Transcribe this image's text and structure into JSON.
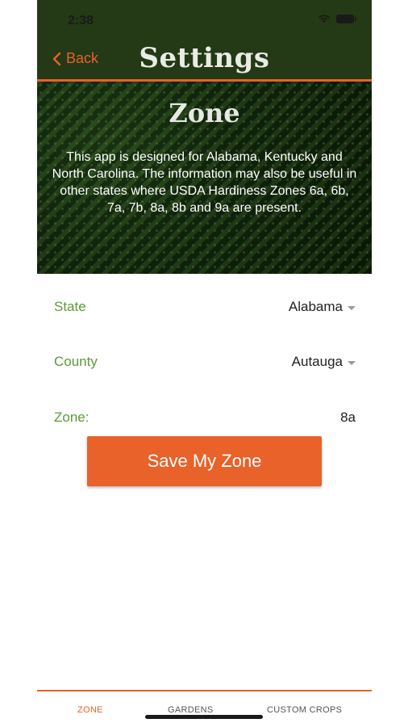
{
  "status_bar": {
    "time": "2:38"
  },
  "nav": {
    "back_label": "Back",
    "title": "Settings"
  },
  "hero": {
    "title": "Zone",
    "description": "This app is designed for Alabama, Kentucky and North Carolina. The information may also be useful in other states where USDA Hardiness Zones 6a, 6b, 7a, 7b, 8a, 8b and 9a are present."
  },
  "form": {
    "state": {
      "label": "State",
      "value": "Alabama"
    },
    "county": {
      "label": "County",
      "value": "Autauga"
    },
    "zone": {
      "label": "Zone:",
      "value": "8a"
    }
  },
  "save_button_label": "Save My Zone",
  "tabs": [
    {
      "label": "ZONE",
      "active": true
    },
    {
      "label": "GARDENS",
      "active": false
    },
    {
      "label": "CUSTOM CROPS",
      "active": false
    }
  ],
  "colors": {
    "accent": "#e8622a",
    "header_bg": "#243915",
    "label_green": "#5b9a37"
  },
  "icons": [
    "wifi-icon",
    "battery-icon",
    "chevron-left-icon",
    "dropdown-caret-icon"
  ]
}
